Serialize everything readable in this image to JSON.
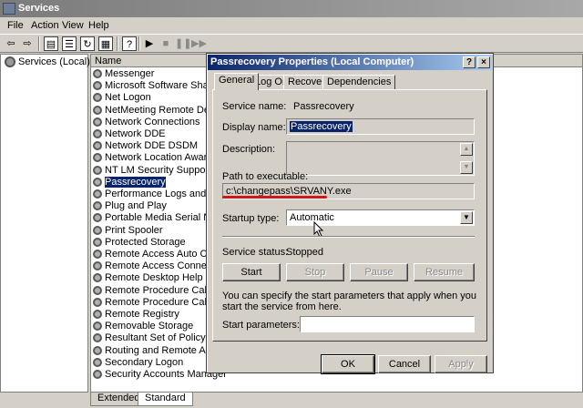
{
  "window": {
    "title": "Services"
  },
  "menu": [
    "File",
    "Action",
    "View",
    "Help"
  ],
  "tree": {
    "root": "Services (Local)"
  },
  "list": {
    "column_name": "Name",
    "rows": [
      "Messenger",
      "Microsoft Software Shadow C",
      "Net Logon",
      "NetMeeting Remote Desktop S",
      "Network Connections",
      "Network DDE",
      "Network DDE DSDM",
      "Network Location Awareness",
      "NT LM Security Support Provid",
      "Passrecovery",
      "Performance Logs and Alerts",
      "Plug and Play",
      "Portable Media Serial Number",
      "Print Spooler",
      "Protected Storage",
      "Remote Access Auto Connect",
      "Remote Access Connection M",
      "Remote Desktop Help Session",
      "Remote Procedure Call (RPC)",
      "Remote Procedure Call (RPC)",
      "Remote Registry",
      "Removable Storage",
      "Resultant Set of Policy Provid",
      "Routing and Remote Access",
      "Secondary Logon",
      "Security Accounts Manager"
    ],
    "selected_index": 9
  },
  "bottom_tabs": [
    "Extended",
    "Standard"
  ],
  "dialog": {
    "title": "Passrecovery Properties (Local Computer)",
    "help_btn": "?",
    "close_btn": "×",
    "tabs": [
      "General",
      "Log On",
      "Recovery",
      "Dependencies"
    ],
    "service_name_label": "Service name:",
    "service_name": "Passrecovery",
    "display_name_label": "Display name:",
    "display_name": "Passrecovery",
    "description_label": "Description:",
    "description": "",
    "path_label": "Path to executable:",
    "path": "c:\\changepass\\SRVANY.exe",
    "startup_label": "Startup type:",
    "startup_value": "Automatic",
    "status_label": "Service status:",
    "status_value": "Stopped",
    "buttons": {
      "start": "Start",
      "stop": "Stop",
      "pause": "Pause",
      "resume": "Resume"
    },
    "hint": "You can specify the start parameters that apply when you start the service from here.",
    "params_label": "Start parameters:",
    "params_value": "",
    "ok": "OK",
    "cancel": "Cancel",
    "apply": "Apply"
  },
  "colors": {
    "selection": "#0a246a",
    "annotation": "#d01818"
  }
}
